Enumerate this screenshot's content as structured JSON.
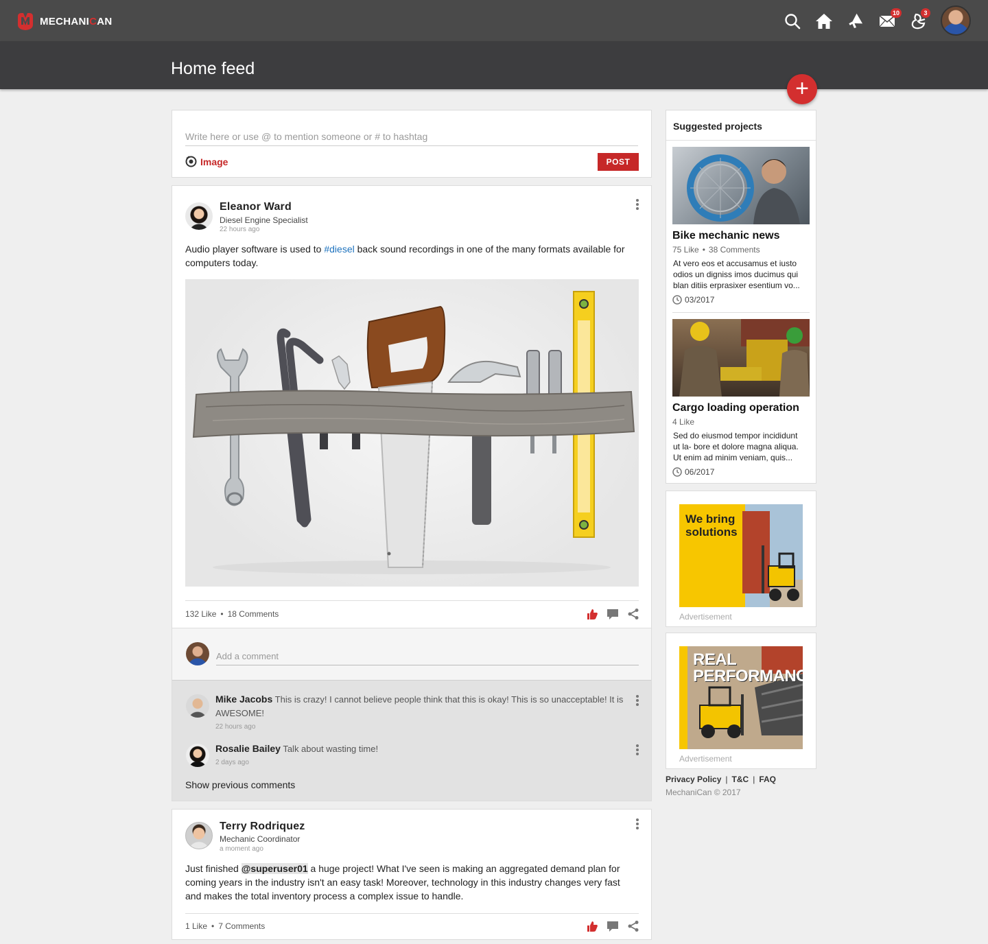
{
  "app": {
    "brand_left": "MECHANI",
    "brand_accent": "C",
    "brand_right": "AN",
    "accent_color": "#d32f2f"
  },
  "nav": {
    "icons": [
      "search-icon",
      "home-icon",
      "megaphone-icon",
      "mail-icon",
      "notifications-icon"
    ],
    "mail_badge": "10",
    "notifications_badge": "3"
  },
  "header": {
    "title": "Home feed"
  },
  "composer": {
    "placeholder": "Write here or use @ to mention someone or # to hashtag",
    "image_label": "Image",
    "post_label": "POST"
  },
  "posts": [
    {
      "author": "Eleanor Ward",
      "role": "Diesel Engine Specialist",
      "time": "22 hours ago",
      "text_before": "Audio player software is used to ",
      "hashtag": "#diesel",
      "text_after": " back sound recordings in one of the many formats available for computers today.",
      "likes": "132 Like",
      "comments_count": "18 Comments",
      "comment_placeholder": "Add a comment",
      "comments": [
        {
          "author": "Mike Jacobs",
          "text": "This is crazy! I cannot believe people think that this is okay! This is so unacceptable! It is AWESOME!",
          "time": "22 hours ago"
        },
        {
          "author": "Rosalie Bailey",
          "text": "Talk about wasting time!",
          "time": "2 days ago"
        }
      ],
      "show_previous": "Show previous comments"
    },
    {
      "author": "Terry Rodriquez",
      "role": "Mechanic Coordinator",
      "time": "a moment ago",
      "text_before": "Just finished ",
      "mention": "@superuser01",
      "text_after": " a huge project! What I've seen is making an aggregated demand plan for coming years in the industry isn't an easy task! Moreover, technology in this industry changes very fast and makes the total inventory process a complex issue to handle.",
      "likes": "1 Like",
      "comments_count": "7 Comments"
    }
  ],
  "sidebar": {
    "title": "Suggested projects",
    "projects": [
      {
        "title": "Bike mechanic news",
        "likes": "75 Like",
        "comments": "38 Comments",
        "desc": "At vero eos et accusamus et iusto odios un digniss imos ducimus qui blan ditiis erprasixer esentium vo...",
        "date": "03/2017"
      },
      {
        "title": "Cargo loading operation",
        "likes": "4 Like",
        "comments": "",
        "desc": "Sed do eiusmod tempor incididunt ut la- bore et dolore magna aliqua. Ut enim ad minim veniam, quis...",
        "date": "06/2017"
      }
    ],
    "ads": [
      {
        "headline": "We bring solutions",
        "label": "Advertisement"
      },
      {
        "headline_1": "REAL",
        "headline_2": "PERFORMANCE",
        "label": "Advertisement"
      }
    ]
  },
  "footer": {
    "privacy": "Privacy Policy",
    "tc": "T&C",
    "faq": "FAQ",
    "copyright": "MechaniCan © 2017"
  }
}
